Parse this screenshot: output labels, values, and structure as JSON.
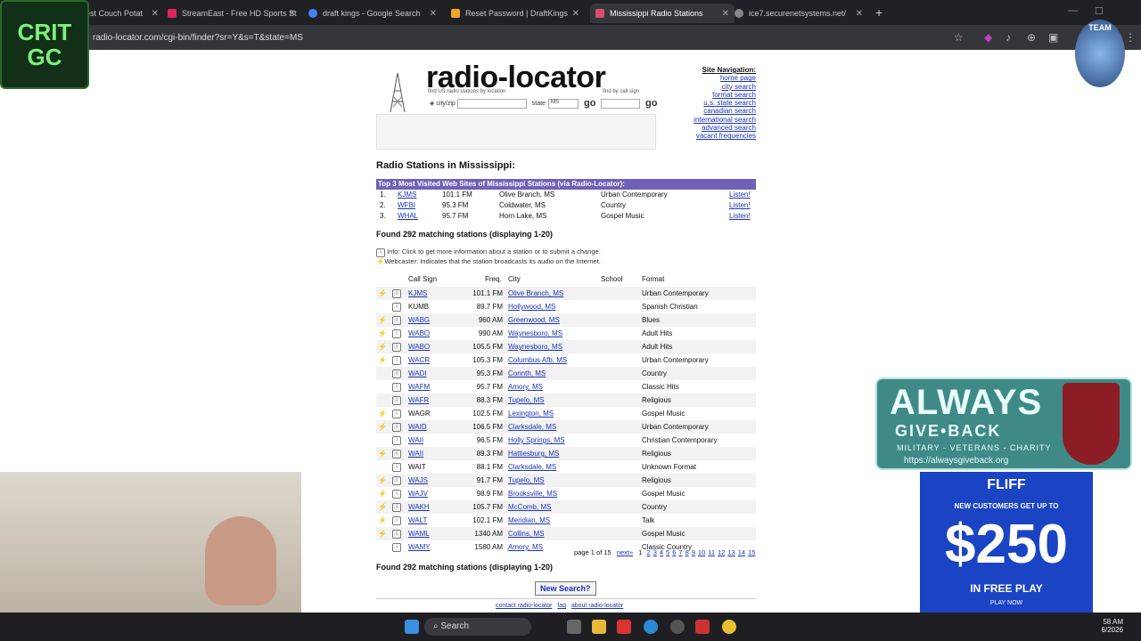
{
  "tabs": [
    {
      "label": "Best Couch Potat"
    },
    {
      "label": "StreamEast - Free HD Sports St"
    },
    {
      "label": "draft kings - Google Search"
    },
    {
      "label": "Reset Password | DraftKings"
    },
    {
      "label": "Mississippi Radio Stations"
    },
    {
      "label": "ice7.securenetsystems.net/"
    }
  ],
  "url": "radio-locator.com/cgi-bin/finder?sr=Y&s=T&state=MS",
  "overlay": {
    "logo_line1": "CRIT",
    "logo_line2": "GC",
    "team_logo": "TEAM"
  },
  "site": {
    "brand": "radio-locator",
    "find_us_text": "find US radio stations by location",
    "find_callsign_text": "find by call sign",
    "city_label": "city/zip",
    "state_label": "state",
    "state_value": "MS",
    "go_label": "go",
    "nav_title": "Site Navigation:",
    "nav": [
      "home page",
      "city search",
      "format search",
      "u.s. state search",
      "canadian search",
      "international search",
      "advanced search",
      "vacant frequencies"
    ]
  },
  "heading": "Radio Stations in Mississippi:",
  "top3": {
    "title": "Top 3 Most Visited Web Sites of Mississippi Stations (via Radio-Locator):",
    "rows": [
      {
        "rank": "1.",
        "call": "KJMS",
        "freq": "101.1 FM",
        "city": "Olive Branch, MS",
        "format": "Urban Contemporary",
        "listen": "Listen!"
      },
      {
        "rank": "2.",
        "call": "WFBI",
        "freq": "95.3 FM",
        "city": "Coldwater, MS",
        "format": "Country",
        "listen": "Listen!"
      },
      {
        "rank": "3.",
        "call": "WHAL",
        "freq": "95.7 FM",
        "city": "Horn Lake, MS",
        "format": "Gospel Music",
        "listen": "Listen!"
      }
    ]
  },
  "found_text": "Found 292 matching stations (displaying 1-20)",
  "info_line": "Info: Click to get more information about a station or to submit a change.",
  "webcaster_line": "Webcaster: Indicates that the station broadcasts its audio on the Internet.",
  "table": {
    "headers": {
      "call": "Call Sign",
      "freq": "Freq.",
      "city": "City",
      "school": "School",
      "format": "Format"
    },
    "rows": [
      {
        "web": true,
        "call": "KJMS",
        "link": true,
        "freq": "101.1 FM",
        "city": "Olive Branch, MS",
        "format": "Urban Contemporary"
      },
      {
        "web": false,
        "call": "KUMB",
        "link": false,
        "freq": "89.7 FM",
        "city": "Hollywood, MS",
        "format": "Spanish Christian"
      },
      {
        "web": true,
        "call": "WABG",
        "link": true,
        "freq": "960 AM",
        "city": "Greenwood, MS",
        "format": "Blues"
      },
      {
        "web": true,
        "call": "WABO",
        "link": true,
        "freq": "990 AM",
        "city": "Waynesboro, MS",
        "format": "Adult Hits"
      },
      {
        "web": true,
        "call": "WABO",
        "link": true,
        "freq": "105.5 FM",
        "city": "Waynesboro, MS",
        "format": "Adult Hits"
      },
      {
        "web": true,
        "call": "WACR",
        "link": true,
        "freq": "105.3 FM",
        "city": "Columbus Afb, MS",
        "format": "Urban Contemporary"
      },
      {
        "web": false,
        "call": "WADI",
        "link": true,
        "freq": "95.3 FM",
        "city": "Corinth, MS",
        "format": "Country"
      },
      {
        "web": false,
        "call": "WAFM",
        "link": true,
        "freq": "95.7 FM",
        "city": "Amory, MS",
        "format": "Classic Hits"
      },
      {
        "web": false,
        "call": "WAFR",
        "link": true,
        "freq": "88.3 FM",
        "city": "Tupelo, MS",
        "format": "Religious"
      },
      {
        "web": true,
        "call": "WAGR",
        "link": false,
        "freq": "102.5 FM",
        "city": "Lexington, MS",
        "format": "Gospel Music"
      },
      {
        "web": true,
        "call": "WAID",
        "link": true,
        "freq": "106.5 FM",
        "city": "Clarksdale, MS",
        "format": "Urban Contemporary"
      },
      {
        "web": false,
        "call": "WAII",
        "link": true,
        "freq": "96.5 FM",
        "city": "Holly Springs, MS",
        "format": "Christian Contemporary"
      },
      {
        "web": true,
        "call": "WAII",
        "link": true,
        "freq": "89.3 FM",
        "city": "Hattiesburg, MS",
        "format": "Religious"
      },
      {
        "web": false,
        "call": "WAIT",
        "link": false,
        "freq": "88.1 FM",
        "city": "Clarksdale, MS",
        "format": "Unknown Format"
      },
      {
        "web": true,
        "call": "WAJS",
        "link": true,
        "freq": "91.7 FM",
        "city": "Tupelo, MS",
        "format": "Religious"
      },
      {
        "web": true,
        "call": "WAJV",
        "link": true,
        "freq": "98.9 FM",
        "city": "Brooksville, MS",
        "format": "Gospel Music"
      },
      {
        "web": true,
        "call": "WAKH",
        "link": true,
        "freq": "105.7 FM",
        "city": "McComb, MS",
        "format": "Country"
      },
      {
        "web": true,
        "call": "WALT",
        "link": true,
        "freq": "102.1 FM",
        "city": "Meridian, MS",
        "format": "Talk"
      },
      {
        "web": true,
        "call": "WAML",
        "link": true,
        "freq": "1340 AM",
        "city": "Collins, MS",
        "format": "Gospel Music"
      },
      {
        "web": false,
        "call": "WAMY",
        "link": true,
        "freq": "1580 AM",
        "city": "Amory, MS",
        "format": "Classic Country"
      }
    ]
  },
  "pager": {
    "text": "page 1 of 15",
    "next": "next»",
    "current": "1",
    "pages": [
      "2",
      "3",
      "4",
      "5",
      "6",
      "7",
      "8",
      "9",
      "10",
      "11",
      "12",
      "13",
      "14",
      "15"
    ]
  },
  "new_search": "New Search?",
  "footer": {
    "contact": "contact radio-locator",
    "faq": "faq",
    "about": "about radio-locator"
  },
  "ad_always": {
    "line1": "ALWAYS",
    "line2": "GIVE•BACK",
    "line3": "MILITARY - VETERANS - CHARITY",
    "url": "https://alwaysgiveback.org"
  },
  "ad_fliff": {
    "brand": "FLIFF",
    "line1": "NEW CUSTOMERS GET UP TO",
    "amount": "$250",
    "line2": "IN FREE PLAY",
    "cta": "PLAY NOW"
  },
  "taskbar": {
    "search": "Search",
    "time": "58 AM",
    "date": "6/2026"
  },
  "colors": {
    "topbar": "#7060b8",
    "link": "#1a33b8",
    "chrome": "#202124"
  }
}
